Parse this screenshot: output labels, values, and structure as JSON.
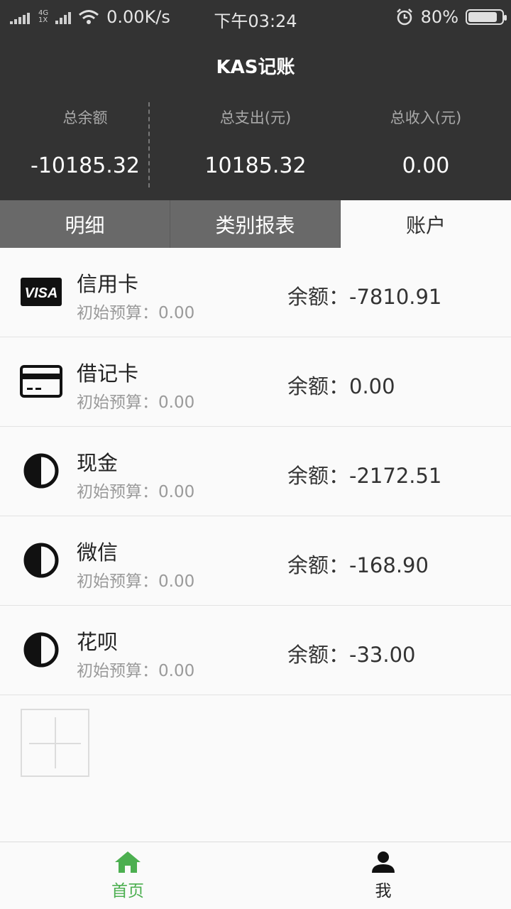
{
  "status_bar": {
    "network_top": "4G",
    "network_bottom": "1X",
    "speed": "0.00K/s",
    "time": "下午03:24",
    "battery": "80%",
    "battery_level": 0.8
  },
  "header": {
    "title": "KAS记账",
    "stats": [
      {
        "label": "总余额",
        "value": "-10185.32"
      },
      {
        "label": "总支出(元)",
        "value": "10185.32"
      },
      {
        "label": "总收入(元)",
        "value": "0.00"
      }
    ]
  },
  "tabs": [
    {
      "label": "明细"
    },
    {
      "label": "类别报表"
    },
    {
      "label": "账户"
    }
  ],
  "accounts": [
    {
      "name": "信用卡",
      "initial": "初始预算：0.00",
      "balance": "余额：-7810.91",
      "icon": "visa-icon"
    },
    {
      "name": "借记卡",
      "initial": "初始预算：0.00",
      "balance": "余额：0.00",
      "icon": "card-icon"
    },
    {
      "name": "现金",
      "initial": "初始预算：0.00",
      "balance": "余额：-2172.51",
      "icon": "contrast-icon"
    },
    {
      "name": "微信",
      "initial": "初始预算：0.00",
      "balance": "余额：-168.90",
      "icon": "contrast-icon"
    },
    {
      "name": "花呗",
      "initial": "初始预算：0.00",
      "balance": "余额：-33.00",
      "icon": "contrast-icon"
    }
  ],
  "bottom_nav": [
    {
      "label": "首页",
      "icon": "home-icon",
      "color": "#4caf50"
    },
    {
      "label": "我",
      "icon": "person-icon",
      "color": "#222222"
    }
  ],
  "visa_text": "VISA"
}
